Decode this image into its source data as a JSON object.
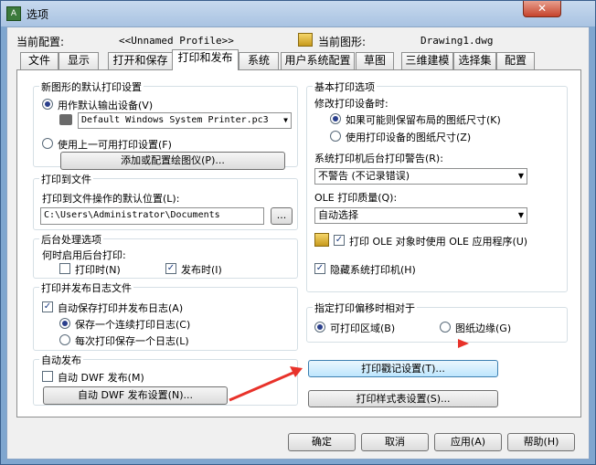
{
  "window": {
    "title": "选项",
    "close_glyph": "✕"
  },
  "header": {
    "current_profile_label": "当前配置:",
    "current_profile_value": "<<Unnamed Profile>>",
    "current_drawing_label": "当前图形:",
    "current_drawing_value": "Drawing1.dwg"
  },
  "tabs": [
    "文件",
    "显示",
    "打开和保存",
    "打印和发布",
    "系统",
    "用户系统配置",
    "草图",
    "三维建模",
    "选择集",
    "配置"
  ],
  "left": {
    "default_output": {
      "title": "新图形的默认打印设置",
      "use_device_label": "用作默认输出设备(V)",
      "device_value": "Default Windows System Printer.pc3",
      "use_last_label": "使用上一可用打印设置(F)",
      "add_plotter_button": "添加或配置绘图仪(P)..."
    },
    "plot_to_file": {
      "title": "打印到文件",
      "location_label": "打印到文件操作的默认位置(L):",
      "location_value": "C:\\Users\\Administrator\\Documents",
      "browse_button": "..."
    },
    "background": {
      "title": "后台处理选项",
      "when_label": "何时启用后台打印:",
      "plotting_label": "打印时(N)",
      "publishing_label": "发布时(I)"
    },
    "log": {
      "title": "打印并发布日志文件",
      "auto_save_label": "自动保存打印并发布日志(A)",
      "continuous_label": "保存一个连续打印日志(C)",
      "per_plot_label": "每次打印保存一个日志(L)"
    },
    "auto_publish": {
      "title": "自动发布",
      "auto_dwf_label": "自动 DWF 发布(M)",
      "settings_button": "自动 DWF 发布设置(N)..."
    }
  },
  "right": {
    "general": {
      "title": "基本打印选项",
      "change_device_label": "修改打印设备时:",
      "keep_layout_label": "如果可能则保留布局的图纸尺寸(K)",
      "use_device_label": "使用打印设备的图纸尺寸(Z)",
      "spooler_label": "系统打印机后台打印警告(R):",
      "spooler_value": "不警告 (不记录错误)",
      "ole_label": "OLE 打印质量(Q):",
      "ole_value": "自动选择",
      "ole_app_label": "打印 OLE 对象时使用 OLE 应用程序(U)",
      "hide_printers_label": "隐藏系统打印机(H)"
    },
    "offset": {
      "title": "指定打印偏移时相对于",
      "printable_label": "可打印区域(B)",
      "edge_label": "图纸边缘(G)"
    },
    "stamp_button": "打印戳记设置(T)...",
    "style_button": "打印样式表设置(S)..."
  },
  "footer": {
    "ok": "确定",
    "cancel": "取消",
    "apply": "应用(A)",
    "help": "帮助(H)"
  }
}
